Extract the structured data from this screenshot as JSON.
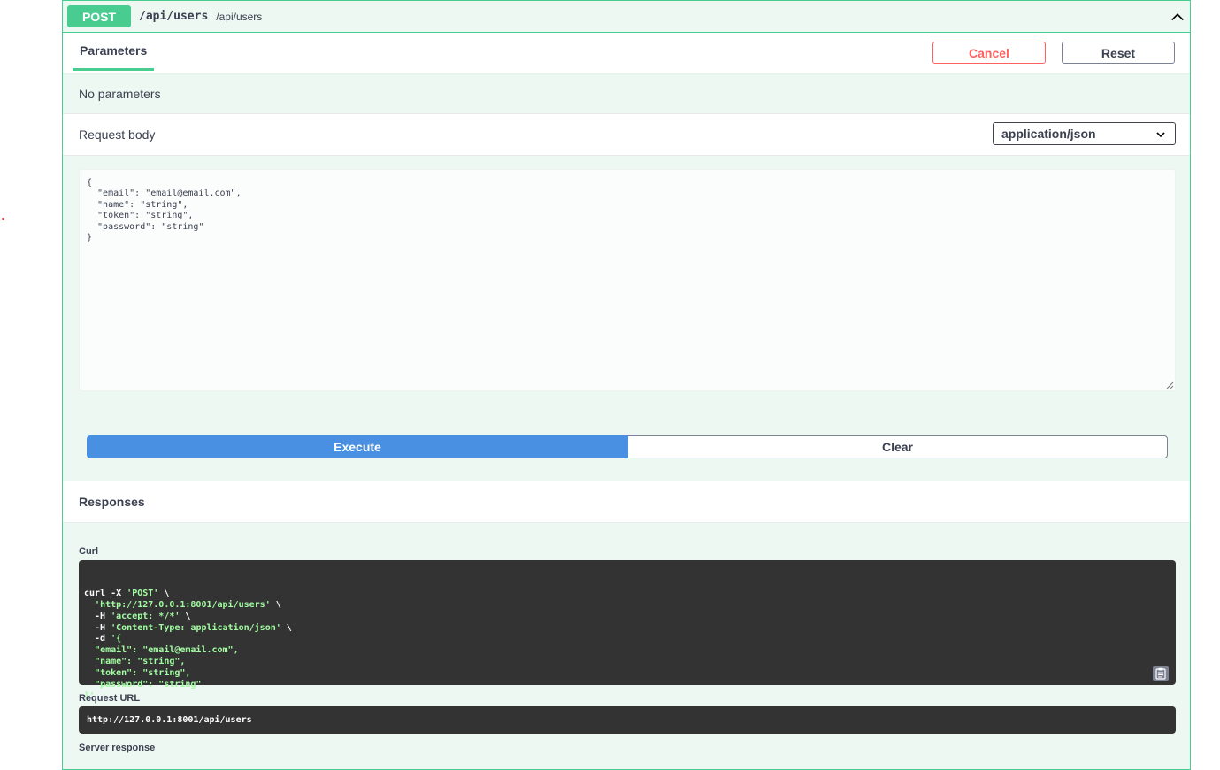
{
  "operation": {
    "method": "POST",
    "path": "/api/users",
    "description": "/api/users"
  },
  "parameters": {
    "tab_label": "Parameters",
    "cancel_label": "Cancel",
    "reset_label": "Reset",
    "empty_text": "No parameters"
  },
  "request_body": {
    "title": "Request body",
    "content_type": "application/json",
    "editor_value": "{\n  \"email\": \"email@email.com\",\n  \"name\": \"string\",\n  \"token\": \"string\",\n  \"password\": \"string\"\n}"
  },
  "actions": {
    "execute_label": "Execute",
    "clear_label": "Clear"
  },
  "responses": {
    "title": "Responses",
    "curl_label": "Curl",
    "curl_lines": [
      {
        "plain": "curl -X ",
        "str": "'POST'",
        "tail": " \\"
      },
      {
        "plain": "  ",
        "str": "'http://127.0.0.1:8001/api/users'",
        "tail": " \\"
      },
      {
        "plain": "  -H ",
        "str": "'accept: */*'",
        "tail": " \\"
      },
      {
        "plain": "  -H ",
        "str": "'Content-Type: application/json'",
        "tail": " \\"
      },
      {
        "plain": "  -d ",
        "str": "'{",
        "tail": ""
      },
      {
        "plain": "  ",
        "str": "\"email\": \"email@email.com\",",
        "tail": ""
      },
      {
        "plain": "  ",
        "str": "\"name\": \"string\",",
        "tail": ""
      },
      {
        "plain": "  ",
        "str": "\"token\": \"string\",",
        "tail": ""
      },
      {
        "plain": "  ",
        "str": "\"password\": \"string\"",
        "tail": ""
      },
      {
        "plain": "",
        "str": "}'",
        "tail": ""
      }
    ],
    "request_url_label": "Request URL",
    "request_url": "http://127.0.0.1:8001/api/users",
    "server_response_label": "Server response"
  },
  "colors": {
    "post_green": "#49cc90",
    "execute_blue": "#4990e2",
    "cancel_red": "#ff6060",
    "code_bg": "#333333"
  },
  "icons": {
    "collapse": "chevron-up-icon",
    "select": "chevron-down-icon",
    "copy": "clipboard-icon"
  }
}
